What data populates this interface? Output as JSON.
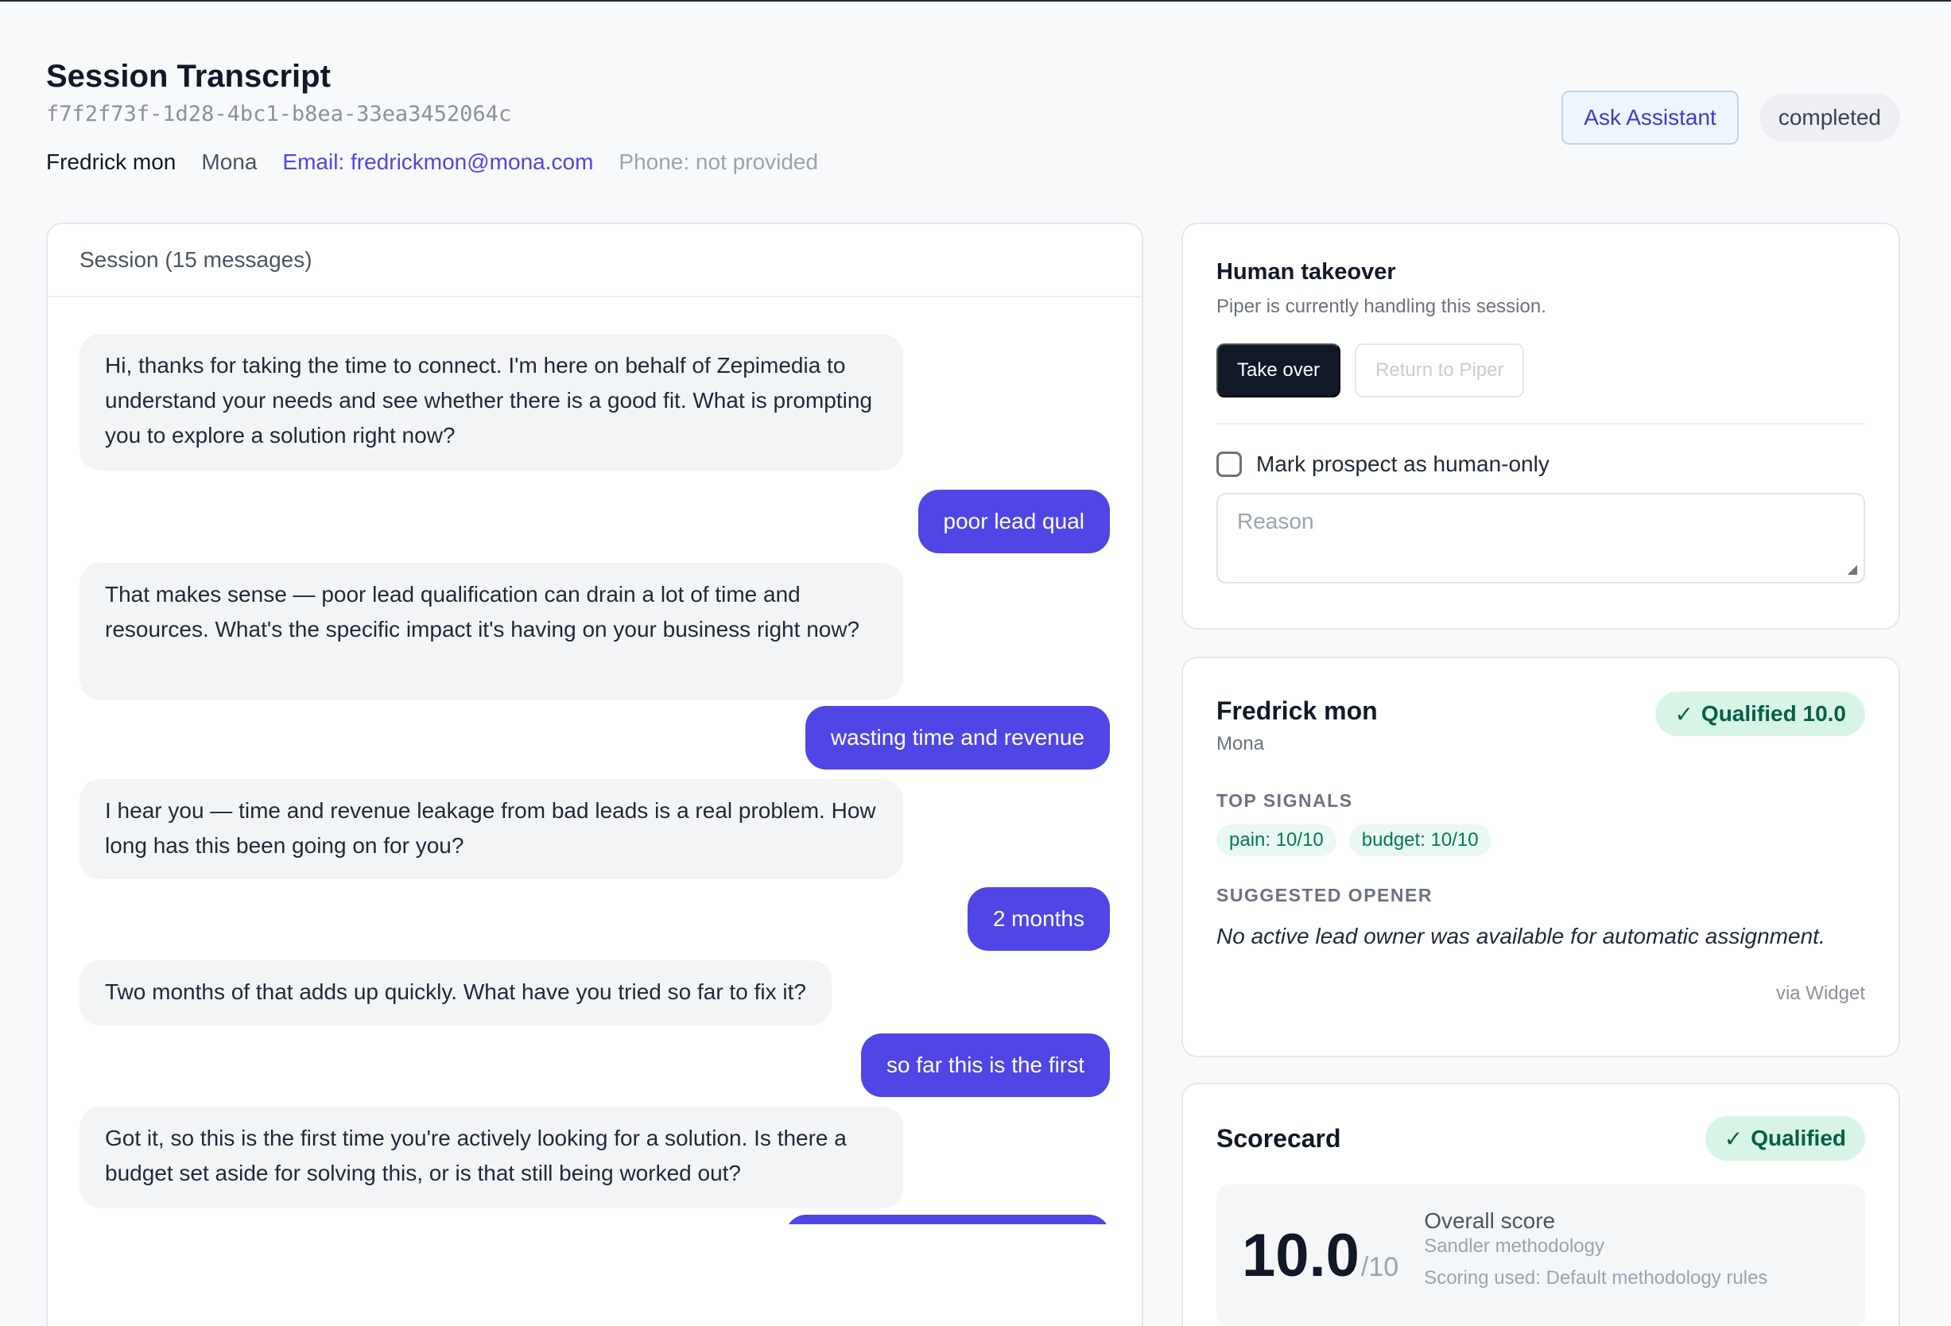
{
  "header": {
    "title": "Session Transcript",
    "session_id": "f7f2f73f-1d28-4bc1-b8ea-33ea3452064c",
    "prospect_name": "Fredrick mon",
    "company": "Mona",
    "email": "Email: fredrickmon@mona.com",
    "phone": "Phone: not provided",
    "ask_button": "Ask Assistant",
    "status": "completed"
  },
  "chat": {
    "header": "Session (15 messages)",
    "messages": [
      {
        "role": "bot",
        "text": "Hi, thanks for taking the time to connect. I'm here on behalf of Zepimedia to understand your needs and see whether there is a good fit. What is prompting you to explore a solution right now?"
      },
      {
        "role": "user",
        "text": "poor lead qual"
      },
      {
        "role": "bot",
        "text": "That makes sense — poor lead qualification can drain a lot of time and resources. What's the specific impact it's having on your business right now?"
      },
      {
        "role": "user",
        "text": "wasting time and revenue"
      },
      {
        "role": "bot",
        "text": "I hear you — time and revenue leakage from bad leads is a real problem. How long has this been going on for you?"
      },
      {
        "role": "user",
        "text": "2 months"
      },
      {
        "role": "bot",
        "text": "Two months of that adds up quickly. What have you tried so far to fix it?"
      },
      {
        "role": "user",
        "text": "so far this is the first"
      },
      {
        "role": "bot",
        "text": "Got it, so this is the first time you're actively looking for a solution. Is there a budget set aside for solving this, or is that still being worked out?"
      },
      {
        "role": "user",
        "text": ""
      }
    ]
  },
  "takeover": {
    "title": "Human takeover",
    "subtitle": "Piper is currently handling this session.",
    "take_over_label": "Take over",
    "return_label": "Return to Piper",
    "human_only_label": "Mark prospect as human-only",
    "human_only_checked": false,
    "reason_placeholder": "Reason"
  },
  "lead": {
    "name": "Fredrick mon",
    "company": "Mona",
    "badge": "Qualified 10.0",
    "signals_heading": "TOP SIGNALS",
    "signals": [
      "pain: 10/10",
      "budget: 10/10"
    ],
    "opener_heading": "SUGGESTED OPENER",
    "opener": "No active lead owner was available for automatic assignment.",
    "source": "via Widget"
  },
  "scorecard": {
    "title": "Scorecard",
    "badge": "Qualified",
    "score": "10.0",
    "score_max": "/10",
    "label": "Overall score",
    "methodology": "Sandler methodology",
    "scoring_used": "Scoring used: Default methodology rules"
  },
  "icons": {
    "check": "check-icon",
    "resize": "resize-grip-icon"
  },
  "colors": {
    "accent": "#4f46e5",
    "qualified_bg": "#d7f5e6",
    "qualified_text": "#065f46",
    "dark_button": "#111827"
  }
}
